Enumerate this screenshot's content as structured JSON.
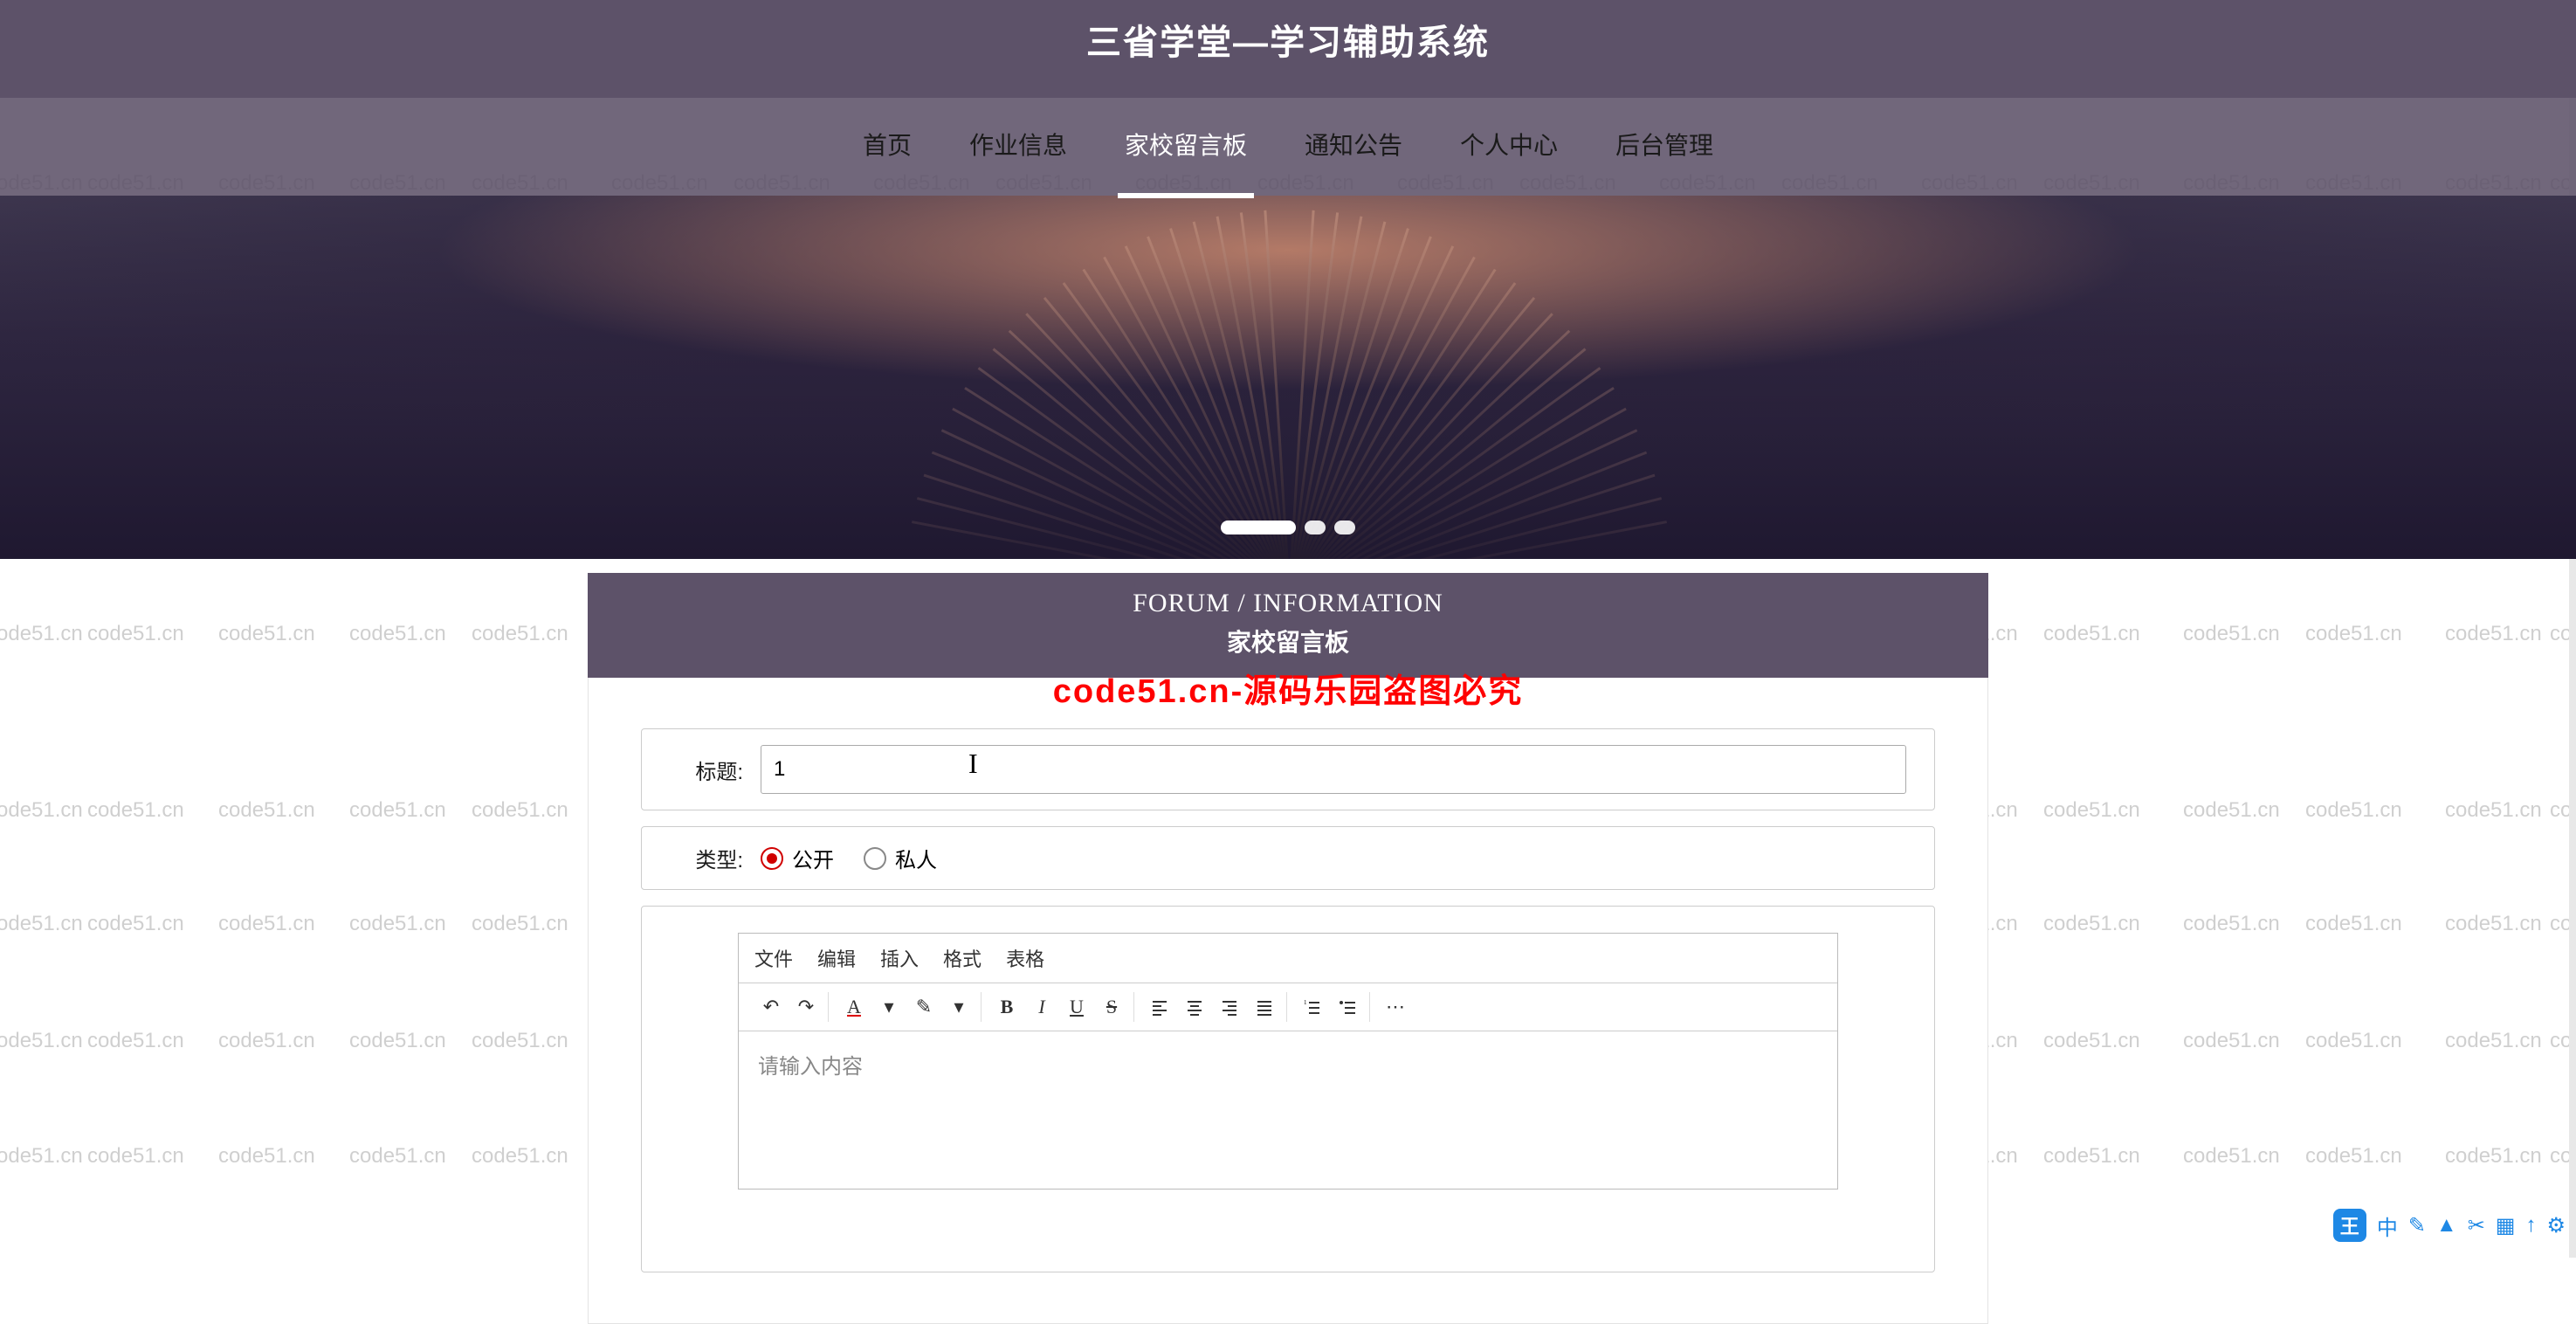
{
  "site": {
    "title": "三省学堂—学习辅助系统"
  },
  "nav": {
    "items": [
      {
        "label": "首页"
      },
      {
        "label": "作业信息"
      },
      {
        "label": "家校留言板"
      },
      {
        "label": "通知公告"
      },
      {
        "label": "个人中心"
      },
      {
        "label": "后台管理"
      }
    ],
    "activeIndex": 2
  },
  "panel": {
    "titleTop": "FORUM / INFORMATION",
    "titleBot": "家校留言板"
  },
  "warning": "code51.cn-源码乐园盗图必究",
  "watermark": "code51.cn",
  "form": {
    "titleLabel": "标题:",
    "titleValue": "1",
    "typeLabel": "类型:",
    "typeOptions": [
      {
        "label": "公开",
        "selected": true
      },
      {
        "label": "私人",
        "selected": false
      }
    ]
  },
  "editor": {
    "menu": [
      "文件",
      "编辑",
      "插入",
      "格式",
      "表格"
    ],
    "placeholder": "请输入内容",
    "toolbar": {
      "undo": "↶",
      "redo": "↷",
      "fontcolor": "A",
      "bgcolor": "✎",
      "bold": "B",
      "italic": "I",
      "underline": "U",
      "strike": "S",
      "aleft": "≡",
      "acenter": "≡",
      "aright": "≡",
      "ajustify": "≡",
      "olist": "≡",
      "ulist": "≡",
      "more": "⋯"
    }
  },
  "tray": {
    "badge": "王",
    "items": [
      "中",
      "✎",
      "▲",
      "✂",
      "▦",
      "↑",
      "⚙"
    ]
  }
}
